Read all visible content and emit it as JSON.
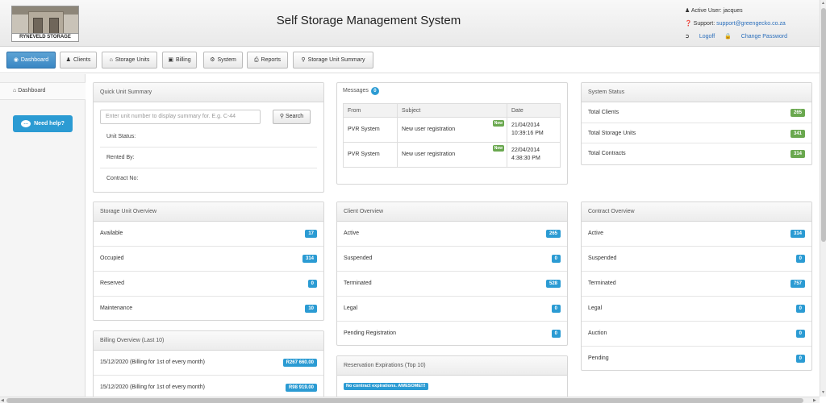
{
  "header": {
    "logo_text": "RYNEVELD STORAGE",
    "title": "Self Storage Management System",
    "active_user": "Active User: jacques",
    "support_label": "Support:",
    "support_email": "support@greengecko.co.za",
    "logoff": "Logoff",
    "change_password": "Change Password"
  },
  "nav": {
    "dashboard": "Dashboard",
    "clients": "Clients",
    "storage_units": "Storage Units",
    "billing": "Billing",
    "system": "System",
    "reports": "Reports",
    "storage_unit_summary": "Storage Unit Summary"
  },
  "sidebar": {
    "dashboard": "Dashboard",
    "need_help": "Need help?"
  },
  "quick_unit_summary": {
    "title": "Quick Unit Summary",
    "placeholder": "Enter unit number to display summary for. E.g. C-44",
    "search": "Search",
    "unit_status": "Unit Status:",
    "rented_by": "Rented By:",
    "contract_no": "Contract No:"
  },
  "messages": {
    "title": "Messages",
    "count": "0",
    "columns": [
      "From",
      "Subject",
      "Date"
    ],
    "rows": [
      {
        "from": "PVR System",
        "subject": "New user registration",
        "badge": "New",
        "date1": "21/04/2014",
        "date2": "10:39:16 PM"
      },
      {
        "from": "PVR System",
        "subject": "New user registration",
        "badge": "New",
        "date1": "22/04/2014",
        "date2": "4:38:30 PM"
      }
    ]
  },
  "system_status": {
    "title": "System Status",
    "rows": [
      {
        "label": "Total Clients",
        "value": "265"
      },
      {
        "label": "Total Storage Units",
        "value": "341"
      },
      {
        "label": "Total Contracts",
        "value": "314"
      }
    ]
  },
  "storage_unit_overview": {
    "title": "Storage Unit Overview",
    "rows": [
      {
        "label": "Available",
        "value": "17"
      },
      {
        "label": "Occupied",
        "value": "314"
      },
      {
        "label": "Reserved",
        "value": "0"
      },
      {
        "label": "Maintenance",
        "value": "10"
      }
    ]
  },
  "client_overview": {
    "title": "Client Overview",
    "rows": [
      {
        "label": "Active",
        "value": "265"
      },
      {
        "label": "Suspended",
        "value": "0"
      },
      {
        "label": "Terminated",
        "value": "528"
      },
      {
        "label": "Legal",
        "value": "0"
      },
      {
        "label": "Pending Registration",
        "value": "0"
      }
    ]
  },
  "contract_overview": {
    "title": "Contract Overview",
    "rows": [
      {
        "label": "Active",
        "value": "314"
      },
      {
        "label": "Suspended",
        "value": "0"
      },
      {
        "label": "Terminated",
        "value": "757"
      },
      {
        "label": "Legal",
        "value": "0"
      },
      {
        "label": "Auction",
        "value": "0"
      },
      {
        "label": "Pending",
        "value": "0"
      }
    ]
  },
  "billing_overview": {
    "title": "Billing Overview (Last 10)",
    "rows": [
      {
        "label": "15/12/2020 (Billing for 1st of every month)",
        "value": "R267 660.00"
      },
      {
        "label": "15/12/2020 (Billing for 1st of every month)",
        "value": "R98 919.00"
      }
    ]
  },
  "reservation_expirations": {
    "title": "Reservation Expirations (Top 10)",
    "message": "No contract expirations. AWESOME!!!"
  },
  "colors": {
    "accent_blue": "#2b9bd3",
    "badge_green": "#6aa84f",
    "active_tab": "#3a87c4"
  }
}
